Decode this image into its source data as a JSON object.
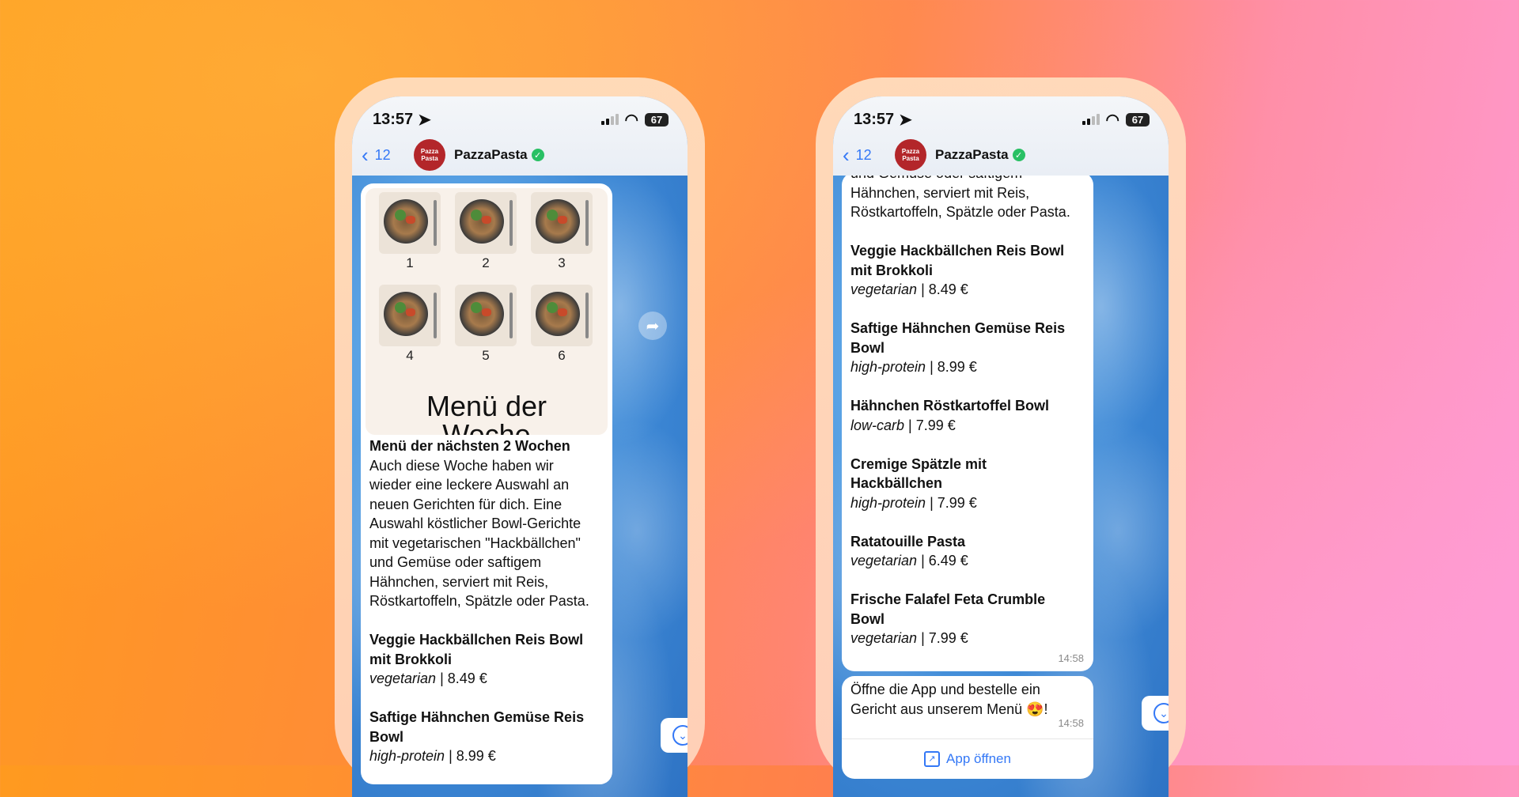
{
  "status_bar": {
    "time": "13:57",
    "battery": "67"
  },
  "chat": {
    "back_count": "12",
    "contact_name": "PazzaPasta",
    "avatar_text_line1": "Pazza",
    "avatar_text_line2": "Pasta"
  },
  "image_card": {
    "labels": [
      "1",
      "2",
      "3",
      "4",
      "5",
      "6"
    ],
    "title_line1": "Menü der",
    "title_line2": "Woche"
  },
  "message": {
    "heading": "Menü der nächsten 2 Wochen",
    "body_lines": [
      "Auch diese Woche haben wir",
      "wieder eine leckere Auswahl an",
      "neuen Gerichten für dich. Eine",
      "Auswahl köstlicher Bowl-Gerichte",
      "mit vegetarischen \"Hackbällchen\"",
      "und Gemüse oder saftigem",
      "Hähnchen, serviert mit Reis,",
      "Röstkartoffeln, Spätzle oder Pasta."
    ],
    "dishes": [
      {
        "name_line1": "Veggie Hackbällchen Reis Bowl",
        "name_line2": "mit Brokkoli",
        "tag": "vegetarian",
        "price": " | 8.49 €"
      },
      {
        "name_line1": "Saftige Hähnchen Gemüse Reis",
        "name_line2": "Bowl",
        "tag": "high-protein",
        "price": " | 8.99 €"
      },
      {
        "name_line1": "Hähnchen Röstkartoffel Bowl",
        "name_line2": "",
        "tag": "low-carb",
        "price": " | 7.99 €"
      },
      {
        "name_line1": "Cremige Spätzle mit",
        "name_line2": "Hackbällchen",
        "tag": "high-protein",
        "price": " | 7.99 €"
      },
      {
        "name_line1": "Ratatouille Pasta",
        "name_line2": "",
        "tag": "vegetarian",
        "price": " | 6.49 €"
      },
      {
        "name_line1": "Frische Falafel Feta Crumble",
        "name_line2": "Bowl",
        "tag": "vegetarian",
        "price": " | 7.99 €"
      }
    ],
    "timestamp": "14:58"
  },
  "cta_message": {
    "line1": "Öffne die App und bestelle ein",
    "line2": "Gericht aus unserem Menü",
    "emoji": "😍",
    "exclam": "!",
    "timestamp": "14:58",
    "button_label": "App öffnen"
  },
  "icons": {
    "location": "location-arrow-icon",
    "wifi": "wifi-icon",
    "signal": "signal-bars-icon",
    "battery": "battery-icon",
    "back": "chevron-left-icon",
    "verified": "verified-check-icon",
    "share": "share-icon",
    "scroll": "chevron-down-icon",
    "open": "open-external-icon"
  }
}
